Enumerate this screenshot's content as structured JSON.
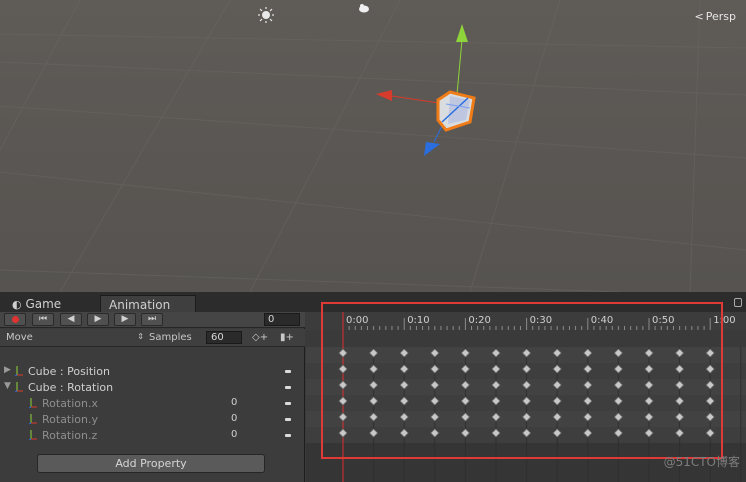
{
  "scene": {
    "view_mode": "Persp",
    "gizmo_icons": [
      "sun-icon",
      "light-icon"
    ],
    "axis_colors": {
      "x": "#d73b2b",
      "y": "#8fd43a",
      "z": "#2b6ee0"
    },
    "selection_color": "#f07c18"
  },
  "tabs": [
    {
      "label": "Game",
      "icon": "game-controller-icon"
    },
    {
      "label": "Animation"
    }
  ],
  "controls": {
    "buttons": [
      "record-icon",
      "go-to-start-icon",
      "previous-key-icon",
      "play-icon",
      "next-key-icon",
      "go-to-end-icon"
    ],
    "frame": "0"
  },
  "clip": {
    "name": "Move",
    "samples_label": "Samples",
    "samples": "60"
  },
  "properties": [
    {
      "label": "Cube : Position",
      "expanded": false,
      "sub": false,
      "value": ""
    },
    {
      "label": "Cube : Rotation",
      "expanded": true,
      "sub": false,
      "value": ""
    },
    {
      "label": "Rotation.x",
      "sub": true,
      "value": "0"
    },
    {
      "label": "Rotation.y",
      "sub": true,
      "value": "0"
    },
    {
      "label": "Rotation.z",
      "sub": true,
      "value": "0"
    }
  ],
  "add_property_label": "Add Property",
  "timeline": {
    "time_labels": [
      "0:00",
      "0:10",
      "0:20",
      "0:30",
      "0:40",
      "0:50",
      "1:00"
    ],
    "keyframe_count_per_row": 13,
    "rows": 6,
    "highlight_color": "#e03a36",
    "playhead_color": "#e02c2c"
  },
  "watermark": "@51CTO博客"
}
